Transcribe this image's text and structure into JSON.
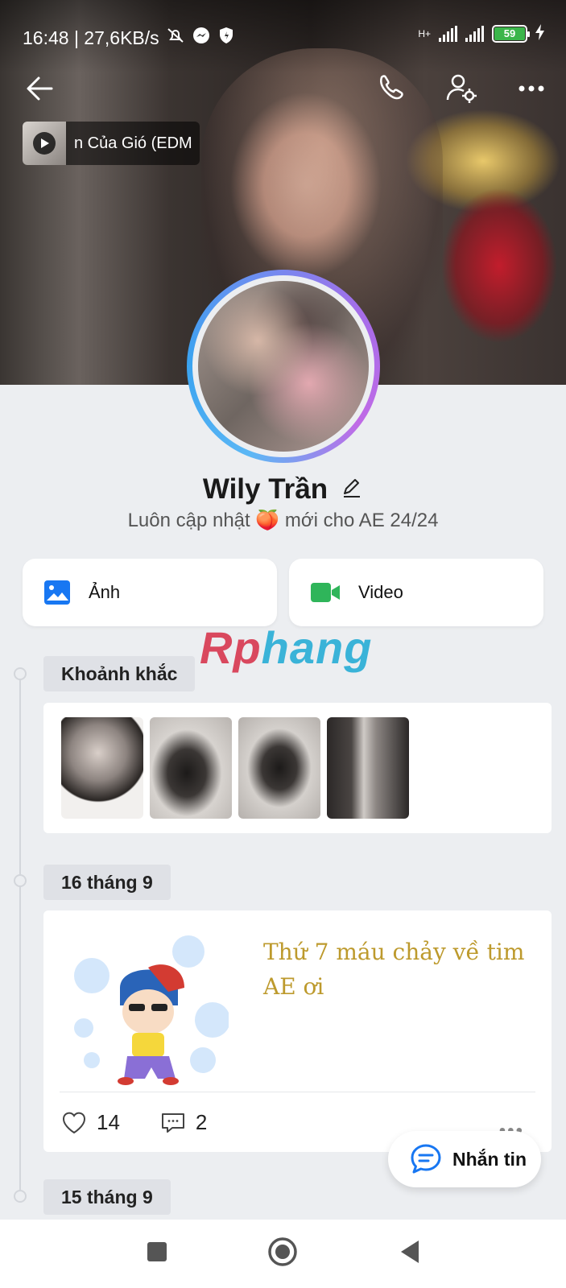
{
  "status_bar": {
    "time_speed": "16:48 | 27,6KB/s",
    "network_type": "H+",
    "battery": "59"
  },
  "music": {
    "title": "n Của Gió (EDM"
  },
  "profile": {
    "name": "Wily Trần",
    "bio": "Luôn cập nhật 🍑 mới cho AE 24/24"
  },
  "media": {
    "photos_label": "Ảnh",
    "video_label": "Video"
  },
  "watermark": {
    "part1": "Rp",
    "part2": "hang"
  },
  "timeline": {
    "moments_label": "Khoảnh khắc",
    "date1": "16 tháng 9",
    "date2": "15 tháng 9"
  },
  "post": {
    "text": "Thứ 7 máu chảy về tim AE ơi",
    "likes": "14",
    "comments": "2",
    "more": "•••"
  },
  "fab": {
    "label": "Nhắn tin"
  },
  "colors": {
    "accent_blue": "#1877f2",
    "video_green": "#2fb55a",
    "post_text": "#bd9a2d",
    "background": "#eceef1"
  }
}
